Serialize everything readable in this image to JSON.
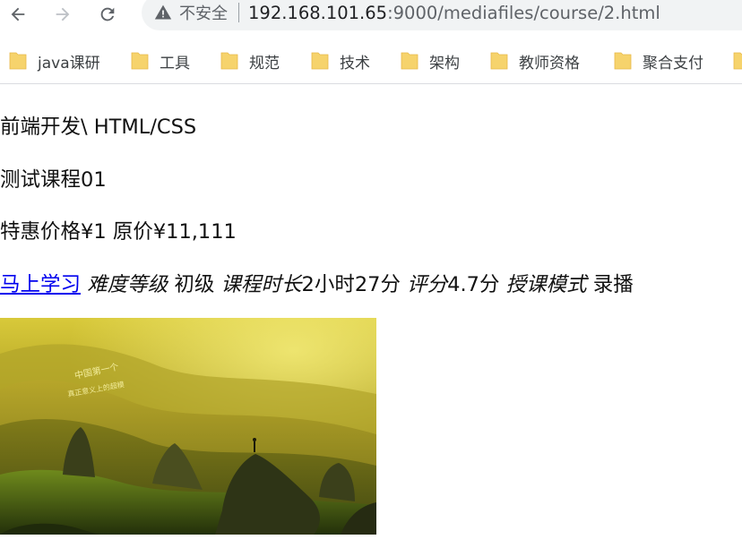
{
  "browser": {
    "security_label": "不安全",
    "url_host": "192.168.101.65",
    "url_rest": ":9000/mediafiles/course/2.html",
    "bookmarks": [
      {
        "label": "java课研"
      },
      {
        "label": "工具"
      },
      {
        "label": "规范"
      },
      {
        "label": "技术"
      },
      {
        "label": "架构"
      },
      {
        "label": "教师资格"
      },
      {
        "label": "聚合支付"
      }
    ],
    "colors": {
      "folder": "#f6d36c",
      "omnibox": "#f1f3f4",
      "link": "#0000ee"
    }
  },
  "course": {
    "category": "前端开发\\ HTML/CSS",
    "name": "测试课程01",
    "price_label": "特惠价格",
    "price": "¥1",
    "original_label": "原价",
    "original_price": "¥11,111",
    "study_link": "马上学习",
    "difficulty_label": "难度等级",
    "difficulty": "初级",
    "duration_label": "课程时长",
    "duration": "2小时27分",
    "rating_label": "评分",
    "rating": "4.7分",
    "mode_label": "授课模式",
    "mode": "录播",
    "cover_caption_line1": "中国第一个",
    "cover_caption_line2": "真正意义上的超模"
  }
}
